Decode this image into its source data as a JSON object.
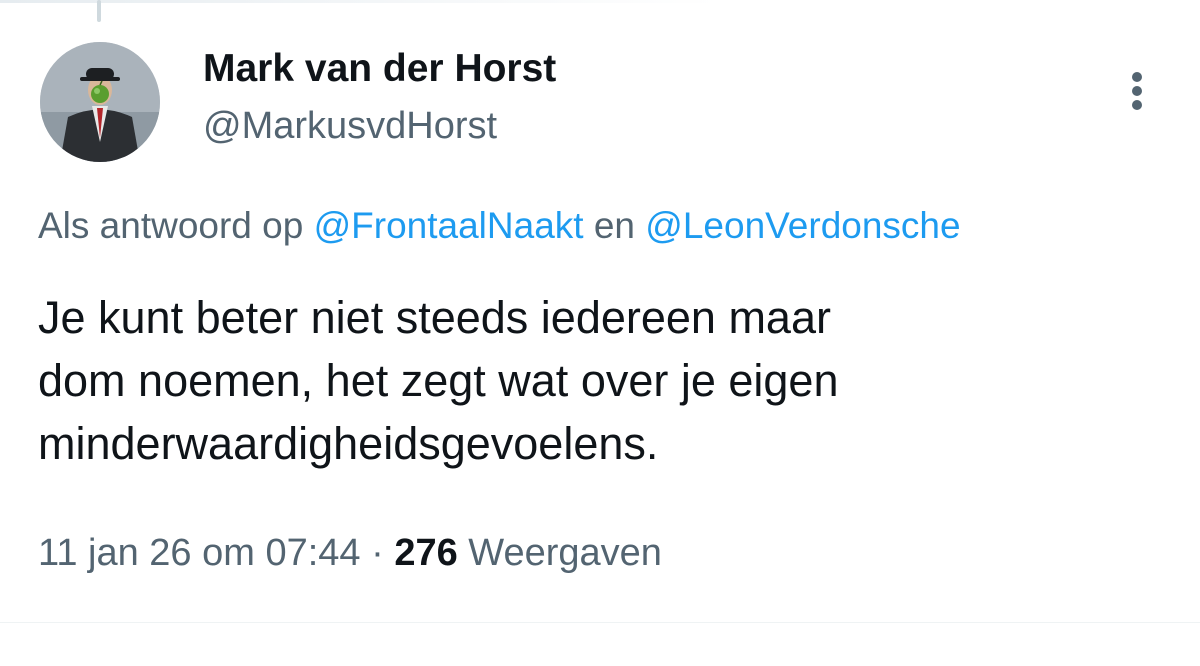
{
  "tweet": {
    "author_name": "Mark van der Horst",
    "author_handle": "@MarkusvdHorst",
    "reply_prefix": "Als antwoord op ",
    "reply_mention_1": "@FrontaalNaakt",
    "reply_joiner": " en ",
    "reply_mention_2": "@LeonVerdonsche",
    "text_lines": [
      "Je kunt beter niet steeds iedereen maar",
      "dom noemen, het zegt wat over je eigen",
      "minderwaardigheidsgevoelens."
    ],
    "timestamp": "11 jan 26 om 07:44",
    "separator": " · ",
    "views_count": "276",
    "views_label": " Weergaven"
  },
  "icons": {
    "more": "more-vertical-icon",
    "avatar": "avatar-image"
  },
  "colors": {
    "text": "#0f1419",
    "secondary": "#536471",
    "link": "#1d9bf0",
    "thread_line": "#cfd9de"
  }
}
